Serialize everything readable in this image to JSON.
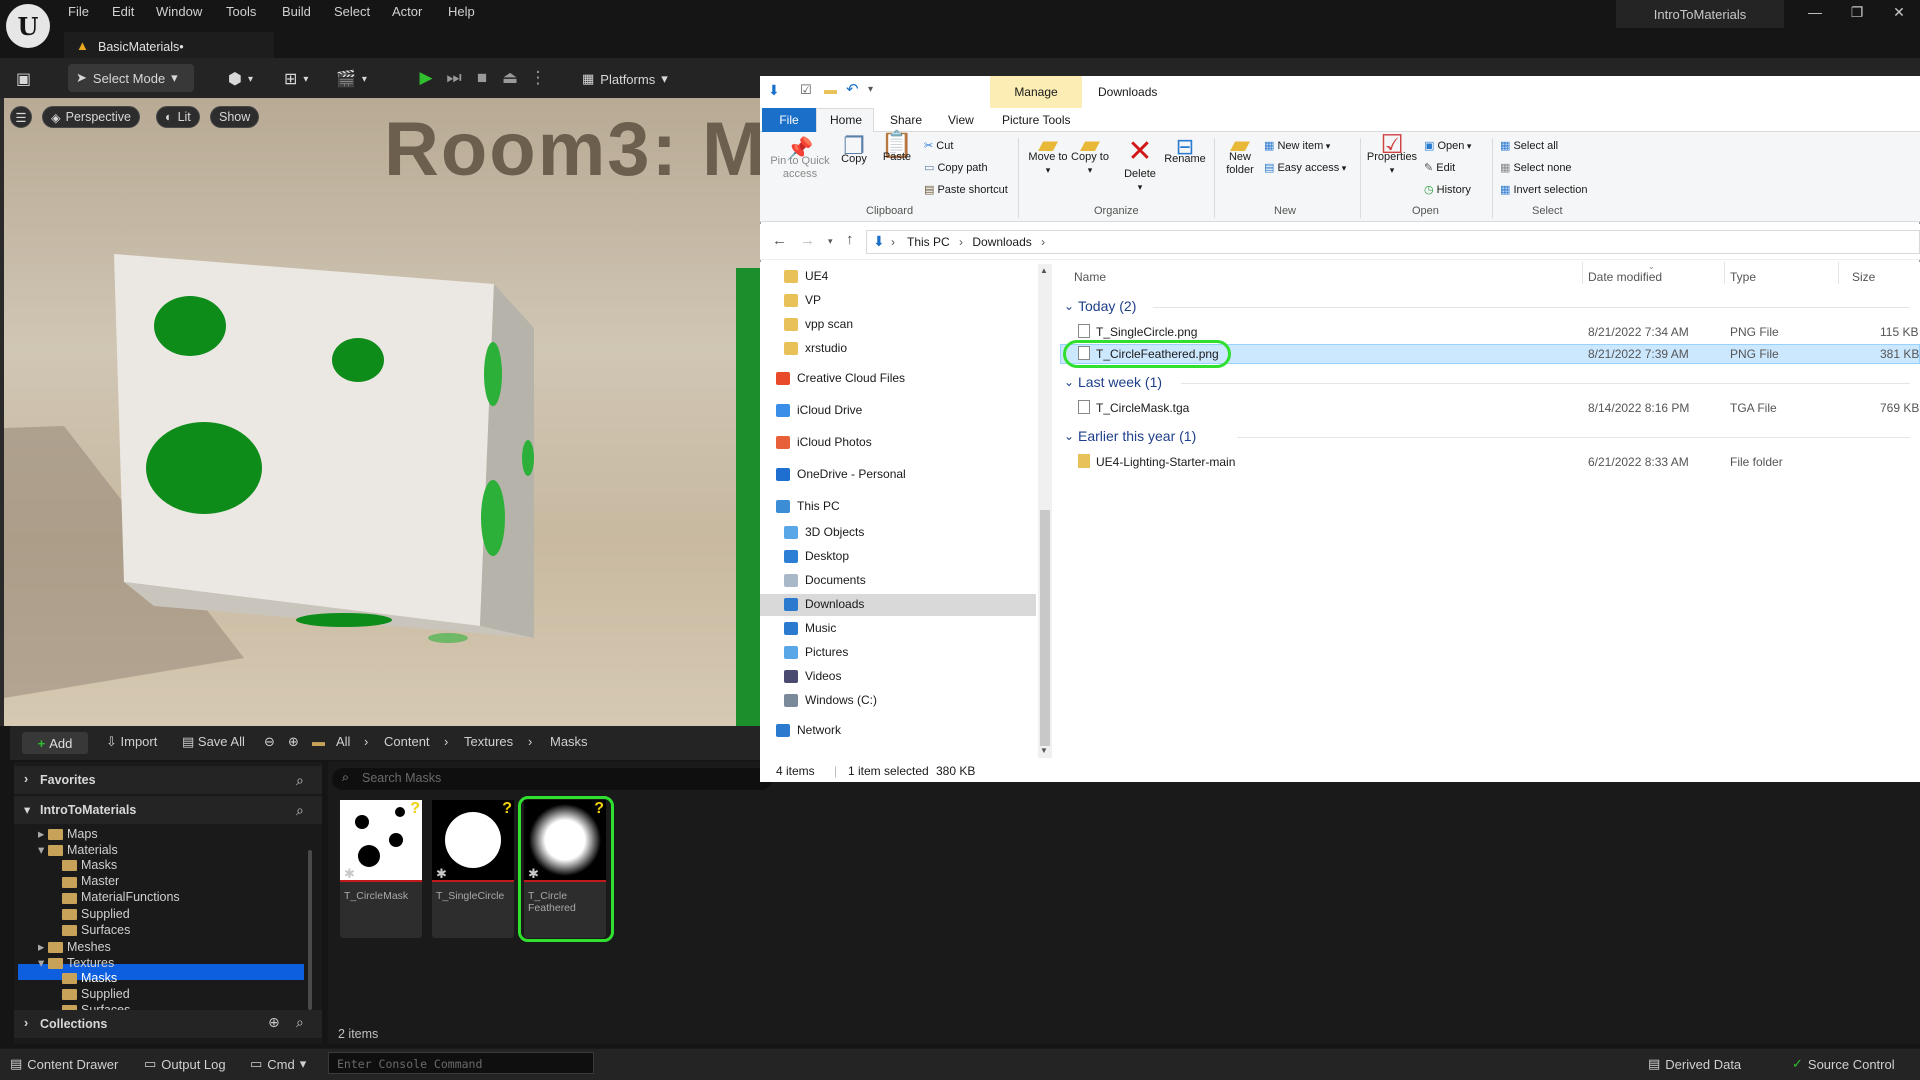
{
  "ue": {
    "menu": [
      "File",
      "Edit",
      "Window",
      "Tools",
      "Build",
      "Select",
      "Actor",
      "Help"
    ],
    "doc_tab": "BasicMaterials•",
    "project_name": "IntroToMaterials",
    "toolbar": {
      "select_mode": "Select Mode",
      "platforms": "Platforms"
    },
    "viewport": {
      "perspective": "Perspective",
      "lit": "Lit",
      "show": "Show",
      "scene_text": "Room3: M"
    },
    "content_drawer": {
      "add": "Add",
      "import": "Import",
      "save_all": "Save All",
      "breadcrumb": [
        "All",
        "Content",
        "Textures",
        "Masks"
      ],
      "favorites": "Favorites",
      "project": "IntroToMaterials",
      "tree": [
        {
          "label": "Maps",
          "indent": 1,
          "expander": "▸"
        },
        {
          "label": "Materials",
          "indent": 1,
          "expander": "▾"
        },
        {
          "label": "Masks",
          "indent": 2,
          "expander": ""
        },
        {
          "label": "Master",
          "indent": 2,
          "expander": ""
        },
        {
          "label": "MaterialFunctions",
          "indent": 2,
          "expander": ""
        },
        {
          "label": "Supplied",
          "indent": 2,
          "expander": ""
        },
        {
          "label": "Surfaces",
          "indent": 2,
          "expander": ""
        },
        {
          "label": "Meshes",
          "indent": 1,
          "expander": "▸"
        },
        {
          "label": "Textures",
          "indent": 1,
          "expander": "▾"
        },
        {
          "label": "Masks",
          "indent": 2,
          "expander": "",
          "selected": true
        },
        {
          "label": "Supplied",
          "indent": 2,
          "expander": ""
        },
        {
          "label": "Surfaces",
          "indent": 2,
          "expander": ""
        }
      ],
      "collections": "Collections",
      "search_placeholder": "Search Masks",
      "assets": [
        {
          "name": "T_CircleMask",
          "thumb": "dots"
        },
        {
          "name": "T_SingleCircle",
          "thumb": "circle"
        },
        {
          "name": "T_Circle Feathered",
          "thumb": "feathered",
          "highlighted": true
        }
      ],
      "item_count": "2 items"
    },
    "status": {
      "content_drawer": "Content Drawer",
      "output_log": "Output Log",
      "cmd": "Cmd",
      "console_placeholder": "Enter Console Command",
      "derived_data": "Derived Data",
      "source_control": "Source Control"
    }
  },
  "explorer": {
    "manage": "Manage",
    "title": "Downloads",
    "tabs": [
      "File",
      "Home",
      "Share",
      "View",
      "Picture Tools"
    ],
    "ribbon": {
      "pin": "Pin to Quick access",
      "copy": "Copy",
      "paste": "Paste",
      "cut": "Cut",
      "copy_path": "Copy path",
      "paste_shortcut": "Paste shortcut",
      "move_to": "Move to",
      "copy_to": "Copy to",
      "delete": "Delete",
      "rename": "Rename",
      "new_folder": "New folder",
      "new_item": "New item",
      "easy_access": "Easy access",
      "properties": "Properties",
      "open": "Open",
      "edit": "Edit",
      "history": "History",
      "select_all": "Select all",
      "select_none": "Select none",
      "invert_selection": "Invert selection",
      "groups": [
        "Clipboard",
        "Organize",
        "New",
        "Open",
        "Select"
      ]
    },
    "address": [
      "This PC",
      "Downloads"
    ],
    "nav": [
      {
        "label": "UE4",
        "icon": "folder-icon",
        "color": "#e8c158",
        "indent": 1
      },
      {
        "label": "VP",
        "icon": "folder-icon",
        "color": "#e8c158",
        "indent": 1
      },
      {
        "label": "vpp scan",
        "icon": "folder-icon",
        "color": "#e8c158",
        "indent": 1
      },
      {
        "label": "xrstudio",
        "icon": "folder-icon",
        "color": "#e8c158",
        "indent": 1
      },
      {
        "label": "Creative Cloud Files",
        "icon": "creative-cloud-icon",
        "color": "#e84a2a",
        "indent": 0,
        "gap": true
      },
      {
        "label": "iCloud Drive",
        "icon": "icloud-icon",
        "color": "#3a8ee8",
        "indent": 0,
        "gap": true
      },
      {
        "label": "iCloud Photos",
        "icon": "photos-icon",
        "color": "#e8603a",
        "indent": 0,
        "gap": true
      },
      {
        "label": "OneDrive - Personal",
        "icon": "onedrive-icon",
        "color": "#1f6fd0",
        "indent": 0,
        "gap": true
      },
      {
        "label": "This PC",
        "icon": "pc-icon",
        "color": "#3b8ed6",
        "indent": 0,
        "gap": true
      },
      {
        "label": "3D Objects",
        "icon": "3d-objects-icon",
        "color": "#5aa7e8",
        "indent": 1
      },
      {
        "label": "Desktop",
        "icon": "desktop-icon",
        "color": "#2d7fd6",
        "indent": 1
      },
      {
        "label": "Documents",
        "icon": "documents-icon",
        "color": "#a8b8c8",
        "indent": 1
      },
      {
        "label": "Downloads",
        "icon": "downloads-icon",
        "color": "#2a7ad0",
        "indent": 1,
        "selected": true
      },
      {
        "label": "Music",
        "icon": "music-icon",
        "color": "#2a7ad0",
        "indent": 1
      },
      {
        "label": "Pictures",
        "icon": "pictures-icon",
        "color": "#5aa7e8",
        "indent": 1
      },
      {
        "label": "Videos",
        "icon": "videos-icon",
        "color": "#4a4a70",
        "indent": 1
      },
      {
        "label": "Windows (C:)",
        "icon": "drive-icon",
        "color": "#7a8a9a",
        "indent": 1
      },
      {
        "label": "Network",
        "icon": "network-icon",
        "color": "#2a7ad0",
        "indent": 0,
        "gap": true
      }
    ],
    "columns": [
      "Name",
      "Date modified",
      "Type",
      "Size"
    ],
    "groups": [
      {
        "title": "Today (2)",
        "files": [
          {
            "name": "T_SingleCircle.png",
            "date": "8/21/2022 7:34 AM",
            "type": "PNG File",
            "size": "115 KB"
          },
          {
            "name": "T_CircleFeathered.png",
            "date": "8/21/2022 7:39 AM",
            "type": "PNG File",
            "size": "381 KB",
            "selected": true
          }
        ]
      },
      {
        "title": "Last week (1)",
        "files": [
          {
            "name": "T_CircleMask.tga",
            "date": "8/14/2022 8:16 PM",
            "type": "TGA File",
            "size": "769 KB"
          }
        ]
      },
      {
        "title": "Earlier this year (1)",
        "files": [
          {
            "name": "UE4-Lighting-Starter-main",
            "date": "6/21/2022 8:33 AM",
            "type": "File folder",
            "size": "",
            "folder": true
          }
        ]
      }
    ],
    "status": {
      "items": "4 items",
      "selected": "1 item selected",
      "size": "380 KB"
    }
  }
}
